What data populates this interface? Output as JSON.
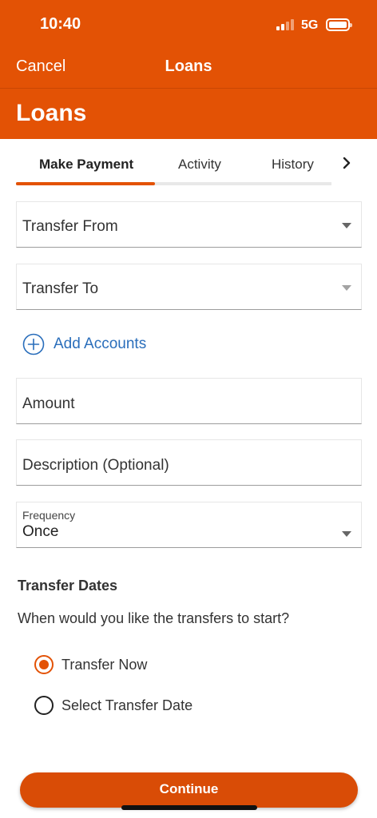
{
  "status_bar": {
    "time": "10:40",
    "network": "5G"
  },
  "nav": {
    "cancel_label": "Cancel",
    "title": "Loans"
  },
  "header": {
    "title": "Loans"
  },
  "tabs": [
    {
      "label": "Make Payment",
      "active": true
    },
    {
      "label": "Activity",
      "active": false
    },
    {
      "label": "History",
      "active": false
    }
  ],
  "form": {
    "transfer_from_label": "Transfer From",
    "transfer_to_label": "Transfer To",
    "add_accounts_label": "Add Accounts",
    "amount_placeholder": "Amount",
    "description_placeholder": "Description (Optional)",
    "frequency": {
      "label": "Frequency",
      "value": "Once"
    }
  },
  "transfer_dates": {
    "title": "Transfer Dates",
    "question": "When would you like the transfers to start?",
    "options": [
      {
        "label": "Transfer Now",
        "selected": true
      },
      {
        "label": "Select Transfer Date",
        "selected": false
      }
    ]
  },
  "continue_label": "Continue",
  "colors": {
    "brand": "#e35205",
    "link": "#2a6ebb"
  },
  "icons": {
    "signal": "signal-icon",
    "battery": "battery-icon",
    "tab_next": "chevron-right-icon",
    "add": "plus-circle-icon",
    "dropdown": "caret-down-icon"
  }
}
